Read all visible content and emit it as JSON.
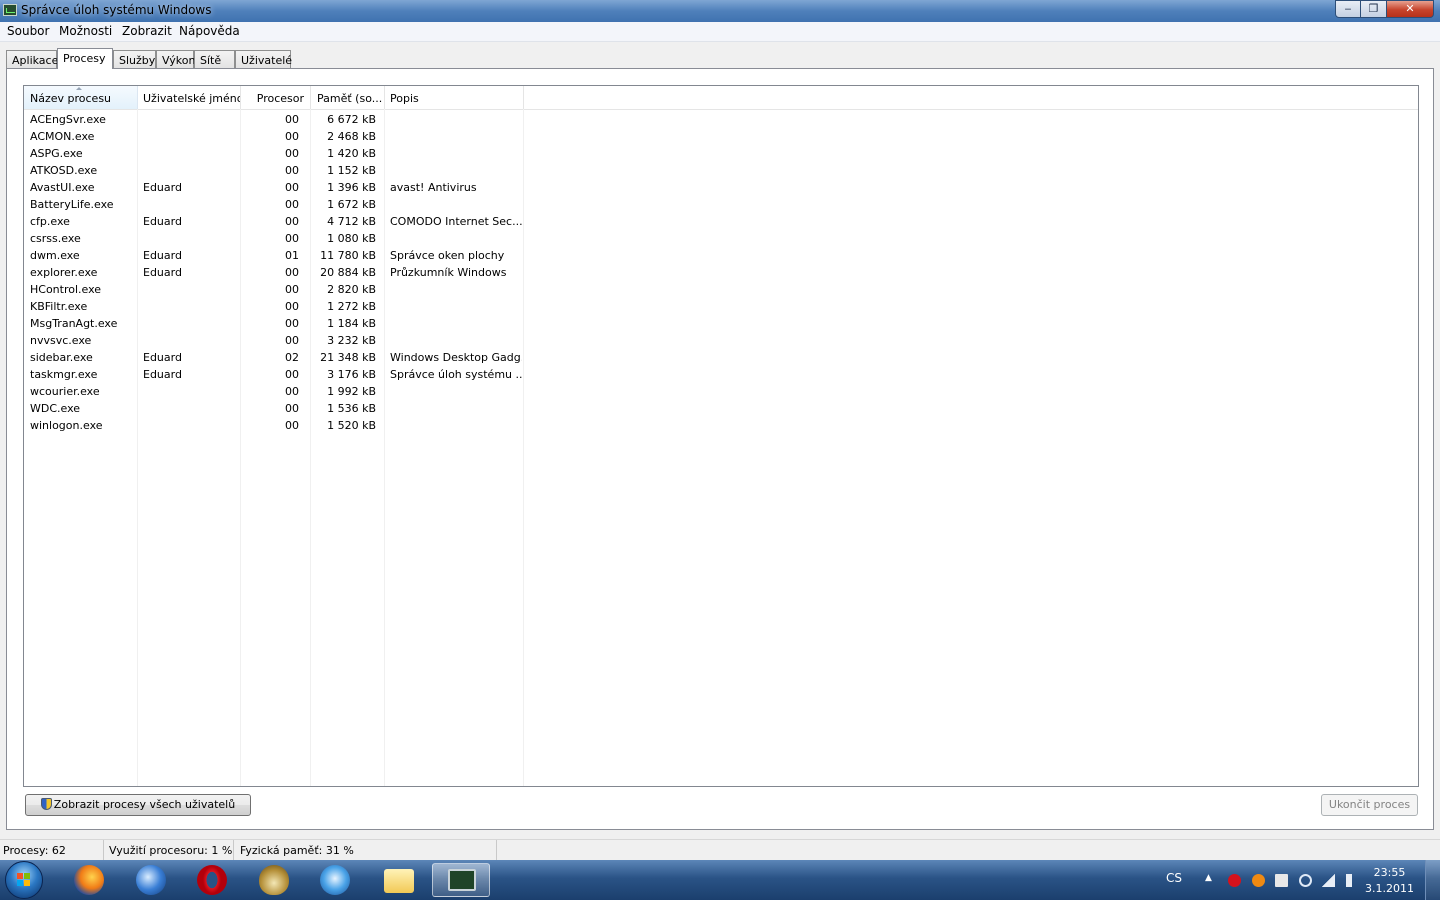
{
  "window": {
    "title": "Správce úloh systému Windows",
    "minimize": "‒",
    "maximize": "❐",
    "close": "✕"
  },
  "menu": [
    "Soubor",
    "Možnosti",
    "Zobrazit",
    "Nápověda"
  ],
  "tabs": [
    "Aplikace",
    "Procesy",
    "Služby",
    "Výkon",
    "Sítě",
    "Uživatelé"
  ],
  "active_tab": "Procesy",
  "columns": [
    "Název procesu",
    "Uživatelské jméno",
    "Procesor",
    "Paměť (so...",
    "Popis"
  ],
  "processes": [
    {
      "name": "ACEngSvr.exe",
      "user": "",
      "cpu": "00",
      "mem": "6 672 kB",
      "desc": ""
    },
    {
      "name": "ACMON.exe",
      "user": "",
      "cpu": "00",
      "mem": "2 468 kB",
      "desc": ""
    },
    {
      "name": "ASPG.exe",
      "user": "",
      "cpu": "00",
      "mem": "1 420 kB",
      "desc": ""
    },
    {
      "name": "ATKOSD.exe",
      "user": "",
      "cpu": "00",
      "mem": "1 152 kB",
      "desc": ""
    },
    {
      "name": "AvastUI.exe",
      "user": "Eduard",
      "cpu": "00",
      "mem": "1 396 kB",
      "desc": "avast! Antivirus"
    },
    {
      "name": "BatteryLife.exe",
      "user": "",
      "cpu": "00",
      "mem": "1 672 kB",
      "desc": ""
    },
    {
      "name": "cfp.exe",
      "user": "Eduard",
      "cpu": "00",
      "mem": "4 712 kB",
      "desc": "COMODO Internet Sec..."
    },
    {
      "name": "csrss.exe",
      "user": "",
      "cpu": "00",
      "mem": "1 080 kB",
      "desc": ""
    },
    {
      "name": "dwm.exe",
      "user": "Eduard",
      "cpu": "01",
      "mem": "11 780 kB",
      "desc": "Správce oken plochy"
    },
    {
      "name": "explorer.exe",
      "user": "Eduard",
      "cpu": "00",
      "mem": "20 884 kB",
      "desc": "Průzkumník Windows"
    },
    {
      "name": "HControl.exe",
      "user": "",
      "cpu": "00",
      "mem": "2 820 kB",
      "desc": ""
    },
    {
      "name": "KBFiltr.exe",
      "user": "",
      "cpu": "00",
      "mem": "1 272 kB",
      "desc": ""
    },
    {
      "name": "MsgTranAgt.exe",
      "user": "",
      "cpu": "00",
      "mem": "1 184 kB",
      "desc": ""
    },
    {
      "name": "nvvsvc.exe",
      "user": "",
      "cpu": "00",
      "mem": "3 232 kB",
      "desc": ""
    },
    {
      "name": "sidebar.exe",
      "user": "Eduard",
      "cpu": "02",
      "mem": "21 348 kB",
      "desc": "Windows Desktop Gadg..."
    },
    {
      "name": "taskmgr.exe",
      "user": "Eduard",
      "cpu": "00",
      "mem": "3 176 kB",
      "desc": "Správce úloh systému ..."
    },
    {
      "name": "wcourier.exe",
      "user": "",
      "cpu": "00",
      "mem": "1 992 kB",
      "desc": ""
    },
    {
      "name": "WDC.exe",
      "user": "",
      "cpu": "00",
      "mem": "1 536 kB",
      "desc": ""
    },
    {
      "name": "winlogon.exe",
      "user": "",
      "cpu": "00",
      "mem": "1 520 kB",
      "desc": ""
    }
  ],
  "buttons": {
    "show_all": "Zobrazit procesy všech uživatelů",
    "end_process": "Ukončit proces"
  },
  "status": {
    "processes": "Procesy: 62",
    "cpu": "Využití procesoru: 1 %",
    "memory": "Fyzická paměť: 31 %"
  },
  "taskbar": {
    "apps": [
      "firefox-icon",
      "google-earth-icon",
      "opera-icon",
      "tor-onion-icon",
      "itunes-icon",
      "explorer-folder-icon",
      "task-manager-icon"
    ],
    "language": "CS",
    "time": "23:55",
    "date": "3.1.2011"
  },
  "colors": {
    "titlebar": "#4f80bb",
    "taskbar": "#2a5386",
    "sorted_header": "#e3f1fb"
  }
}
